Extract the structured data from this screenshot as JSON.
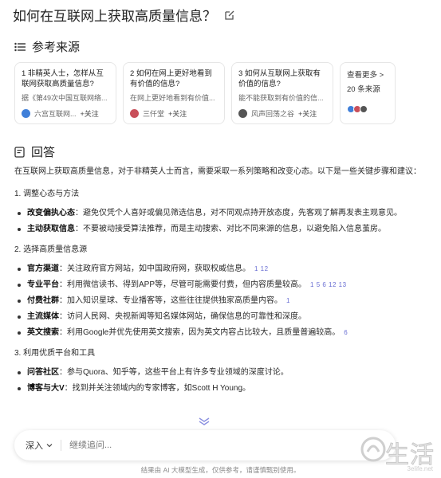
{
  "header": {
    "title": "如何在互联网上获取高质量信息？"
  },
  "sources": {
    "heading": "参考来源",
    "cards": [
      {
        "title": "1 非精英人士，怎样从互联网获取高质量信息?",
        "snippet": "据《第49次中国互联网络...",
        "source": "六宫互联网...",
        "follow": "+关注",
        "color": "#3f7fd9"
      },
      {
        "title": "2 如何在网上更好地看到有价值的信息?",
        "snippet": "在网上更好地看到有价值...",
        "source": "三仟堂",
        "follow": "+关注",
        "color": "#c94f5a"
      },
      {
        "title": "3 如何从互联网上获取有价值的信息?",
        "snippet": "能不能获取到有价值的信...",
        "source": "风声回荡之谷",
        "follow": "+关注",
        "color": "#555555"
      }
    ],
    "more": {
      "label": "查看更多 >",
      "count": "20 条来源"
    }
  },
  "answer": {
    "heading": "回答",
    "intro": "在互联网上获取高质量信息，对于非精英人士而言，需要采取一系列策略和改变心态。以下是一些关键步骤和建议：",
    "sections": [
      {
        "heading": "1. 调整心态与方法",
        "items": [
          {
            "label": "改变偏执心态",
            "text": "：避免仅凭个人喜好或偏见筛选信息，对不同观点持开放态度，先客观了解再发表主观意见。",
            "cite": ""
          },
          {
            "label": "主动获取信息",
            "text": "：不要被动接受算法推荐，而是主动搜索、对比不同来源的信息，以避免陷入信息茧房。",
            "cite": ""
          }
        ]
      },
      {
        "heading": "2. 选择高质量信息源",
        "items": [
          {
            "label": "官方渠道",
            "text": "：关注政府官方网站，如中国政府网，获取权威信息。",
            "cite": "1 12"
          },
          {
            "label": "专业平台",
            "text": "：利用微信读书、得到APP等，尽管可能需要付费，但内容质量较高。",
            "cite": "1 5 6 12 13"
          },
          {
            "label": "付费社群",
            "text": "：加入知识星球、专业播客等，这些往往提供独家高质量内容。",
            "cite": "1"
          },
          {
            "label": "主流媒体",
            "text": "：访问人民网、央视新闻等知名媒体网站，确保信息的可靠性和深度。",
            "cite": ""
          },
          {
            "label": "英文搜索",
            "text": "：利用Google并优先使用英文搜索，因为英文内容占比较大，且质量普遍较高。",
            "cite": "6"
          }
        ]
      },
      {
        "heading": "3. 利用优质平台和工具",
        "items": [
          {
            "label": "问答社区",
            "text": "：参与Quora、知乎等，这些平台上有许多专业领域的深度讨论。",
            "cite": ""
          },
          {
            "label": "博客与大V",
            "text": "：找到并关注领域内的专家博客，如Scott H Young。",
            "cite": ""
          }
        ]
      }
    ]
  },
  "input": {
    "mode": "深入",
    "placeholder": "继续追问..."
  },
  "footer": {
    "disclaimer": "结果由 AI 大模型生成，仅供参考，请谨慎甄别使用。"
  },
  "watermark": {
    "text": "生活",
    "url": "3elife.net"
  }
}
